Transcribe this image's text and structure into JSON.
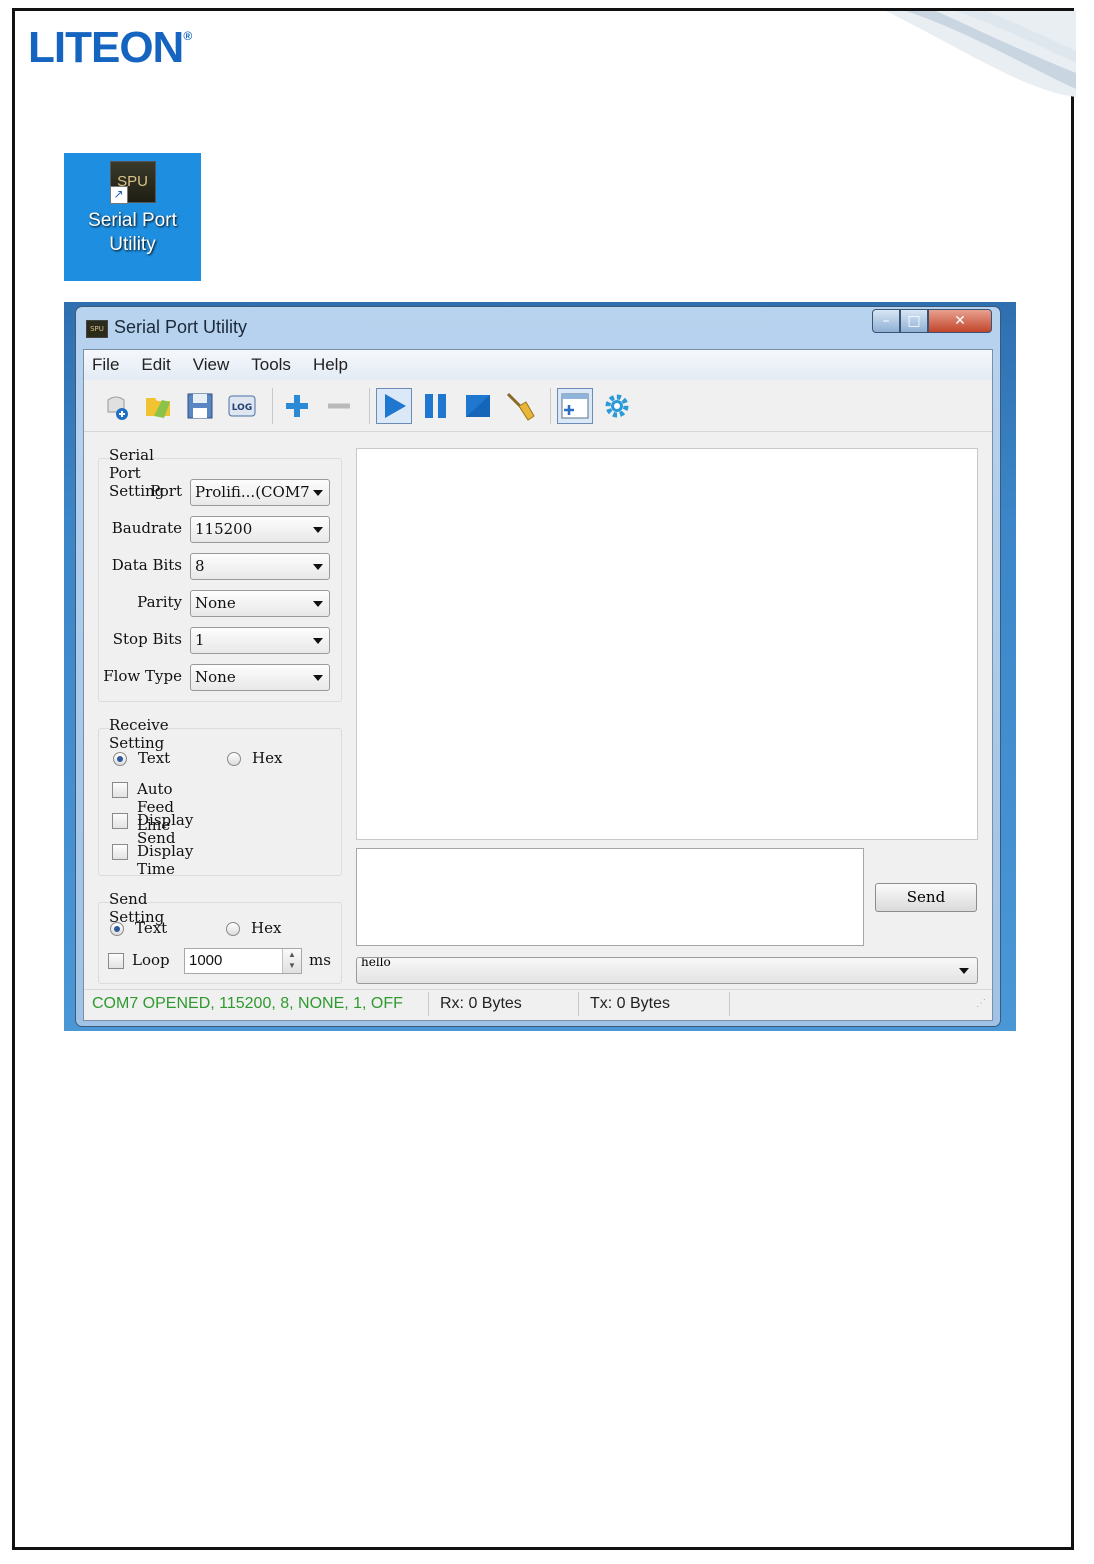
{
  "brand": {
    "logo_text": "LITEON",
    "registered_mark": "®",
    "brand_color": "#1565c0"
  },
  "desktop_shortcut": {
    "icon_text": "SPU",
    "label_line1": "Serial Port",
    "label_line2": "Utility",
    "background": "#1e8fe0"
  },
  "window": {
    "title": "Serial Port Utility",
    "app_icon_text": "SPU",
    "caption": {
      "minimize": "–",
      "maximize": "□",
      "close": "✕"
    }
  },
  "menubar": {
    "items": [
      "File",
      "Edit",
      "View",
      "Tools",
      "Help"
    ]
  },
  "toolbar": {
    "icons": [
      "new-icon",
      "open-folder-icon",
      "save-icon",
      "log-icon",
      "add-icon",
      "remove-icon",
      "play-icon",
      "pause-icon",
      "stop-icon",
      "clear-broom-icon",
      "new-window-icon",
      "settings-gear-icon"
    ],
    "log_label": "LOG"
  },
  "serial_port_setting": {
    "title": "Serial Port Setting",
    "fields": [
      {
        "label": "Port",
        "value": "Prolifi...(COM7"
      },
      {
        "label": "Baudrate",
        "value": "115200"
      },
      {
        "label": "Data Bits",
        "value": "8"
      },
      {
        "label": "Parity",
        "value": "None"
      },
      {
        "label": "Stop Bits",
        "value": "1"
      },
      {
        "label": "Flow Type",
        "value": "None"
      }
    ]
  },
  "receive_setting": {
    "title": "Receive Setting",
    "radio_text": "Text",
    "radio_hex": "Hex",
    "selected": "Text",
    "auto_feed_line": "Auto Feed Line",
    "display_send": "Display Send",
    "display_time": "Display Time"
  },
  "send_setting": {
    "title": "Send Setting",
    "radio_text": "Text",
    "radio_hex": "Hex",
    "selected": "Text",
    "loop_label": "Loop",
    "loop_interval": "1000",
    "unit": "ms"
  },
  "send_panel": {
    "send_button": "Send",
    "history_value": "hello"
  },
  "status_bar": {
    "connection": "COM7 OPENED, 115200, 8, NONE, 1, OFF",
    "connection_color": "#2f9a2f",
    "rx": "Rx: 0 Bytes",
    "tx": "Tx: 0 Bytes"
  }
}
